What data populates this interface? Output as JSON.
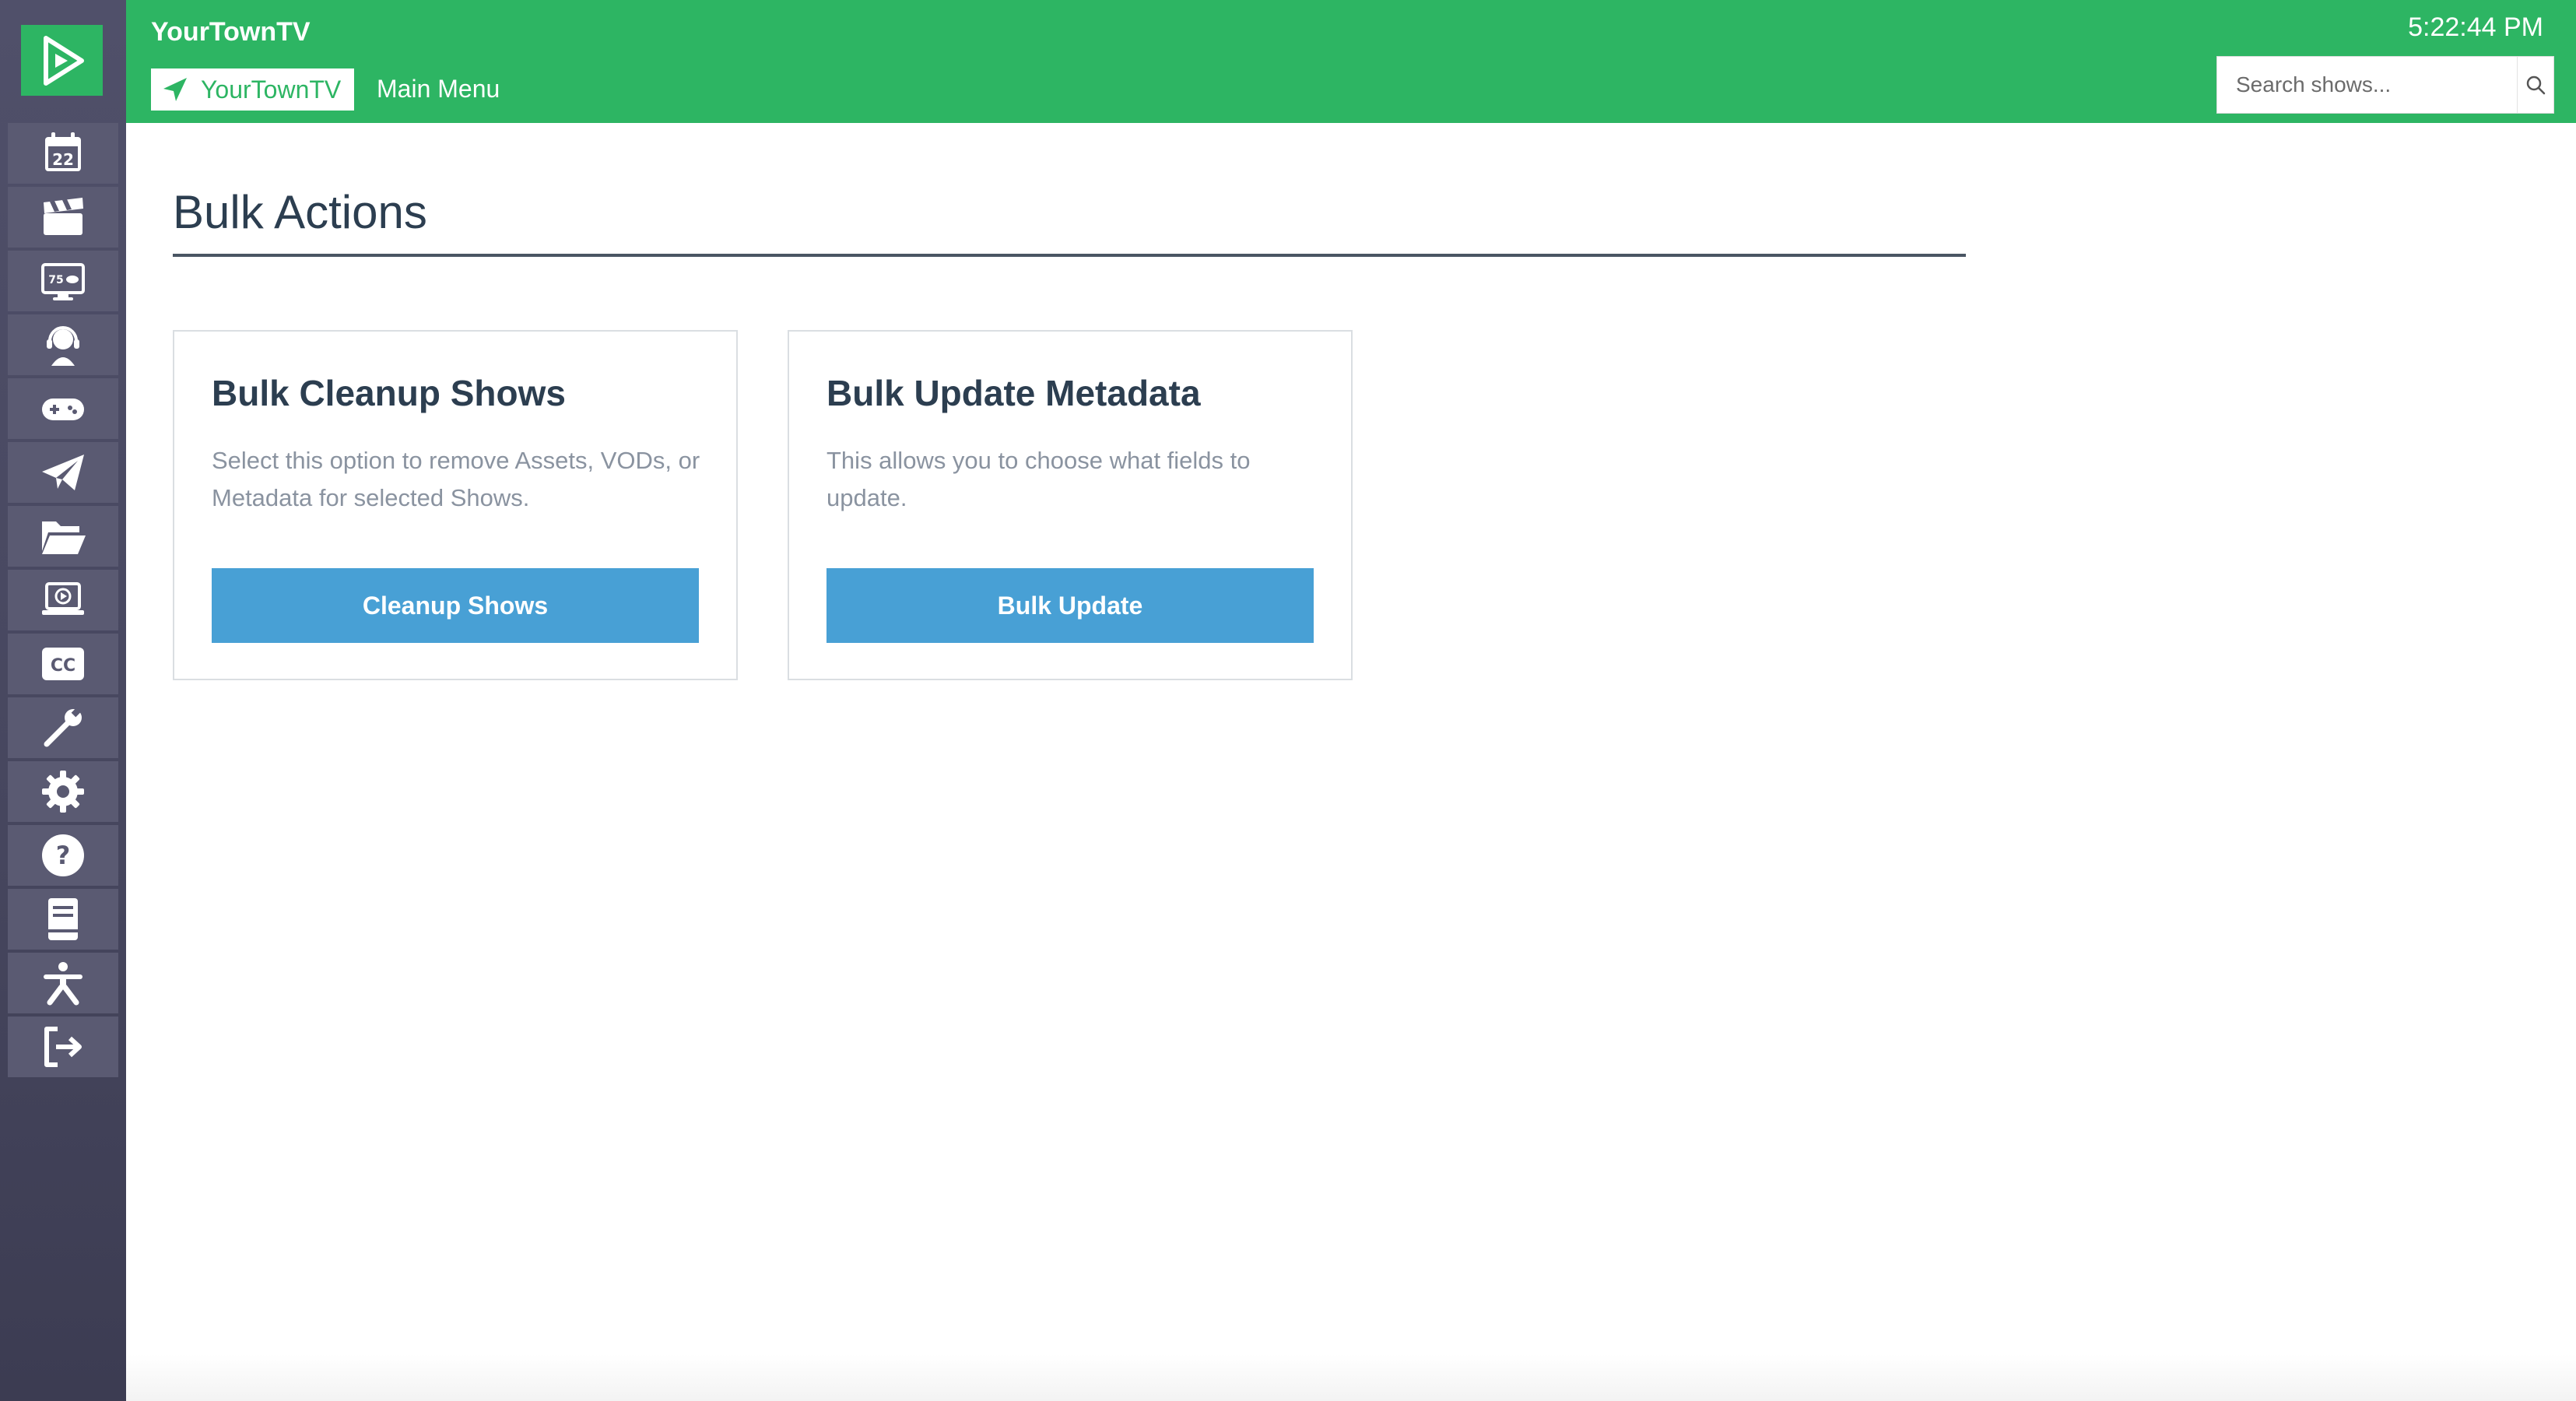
{
  "app": {
    "brand": "YourTownTV",
    "location": "YourTownTV",
    "main_menu": "Main Menu",
    "clock": "5:22:44 PM"
  },
  "search": {
    "placeholder": "Search shows..."
  },
  "sidebar": {
    "items": [
      {
        "icon": "calendar-icon",
        "badge": "22"
      },
      {
        "icon": "clapperboard-icon"
      },
      {
        "icon": "tv-channel-icon",
        "badge": "75"
      },
      {
        "icon": "headset-icon"
      },
      {
        "icon": "gamepad-icon"
      },
      {
        "icon": "paper-plane-icon"
      },
      {
        "icon": "folder-open-icon"
      },
      {
        "icon": "laptop-play-icon"
      },
      {
        "icon": "closed-captions-icon",
        "badge": "CC"
      },
      {
        "icon": "wrench-icon"
      },
      {
        "icon": "gear-icon"
      },
      {
        "icon": "help-icon"
      },
      {
        "icon": "book-icon"
      },
      {
        "icon": "accessibility-icon"
      },
      {
        "icon": "sign-out-icon"
      }
    ]
  },
  "page": {
    "title": "Bulk Actions"
  },
  "cards": [
    {
      "title": "Bulk Cleanup Shows",
      "description": "Select this option to remove Assets, VODs, or Metadata for selected Shows.",
      "button": "Cleanup Shows"
    },
    {
      "title": "Bulk Update Metadata",
      "description": "This allows you to choose what fields to update.",
      "button": "Bulk Update"
    }
  ],
  "colors": {
    "brand_green": "#2db563",
    "sidebar": "#4a4a62",
    "button_blue": "#48a0d5",
    "heading": "#2c3e50"
  }
}
